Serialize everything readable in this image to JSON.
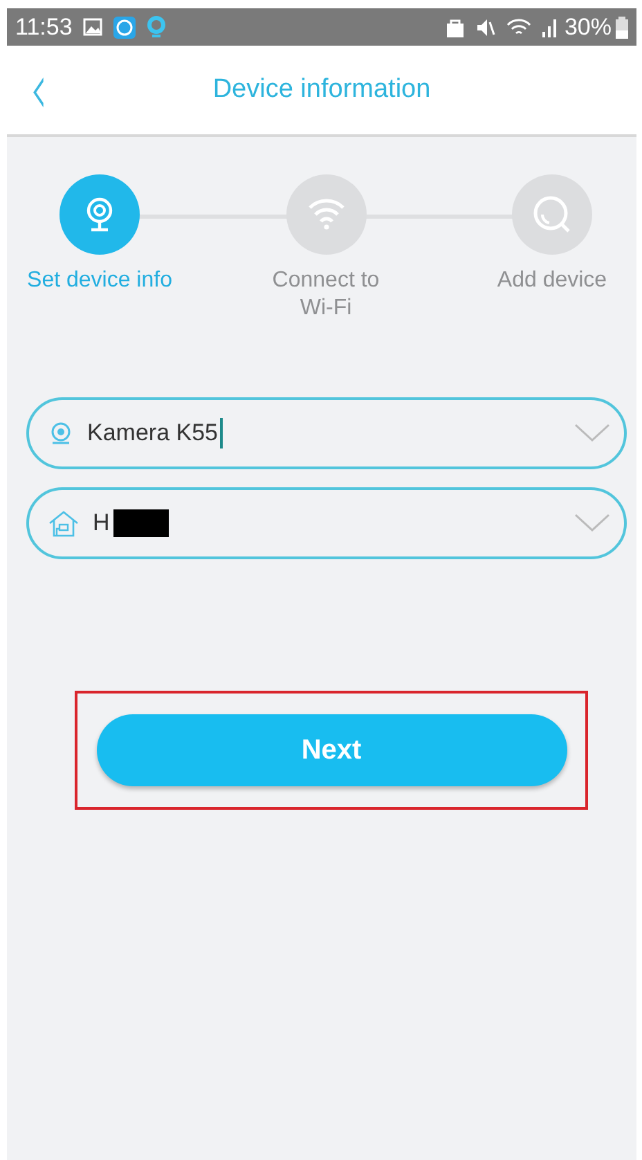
{
  "status_bar": {
    "time": "11:53",
    "battery": "30%"
  },
  "header": {
    "back": "‹",
    "title": "Device information"
  },
  "steps": [
    {
      "kind": "camera",
      "label": "Set device info",
      "active": true
    },
    {
      "kind": "wifi",
      "label": "Connect to Wi-Fi",
      "active": false
    },
    {
      "kind": "search",
      "label": "Add device",
      "active": false
    }
  ],
  "fields": [
    {
      "kind": "camera",
      "value": "Kamera K55",
      "focused": true,
      "redacted": false
    },
    {
      "kind": "home",
      "value": "H",
      "focused": false,
      "redacted": true
    }
  ],
  "next_button": {
    "label": "Next",
    "highlighted": true
  }
}
